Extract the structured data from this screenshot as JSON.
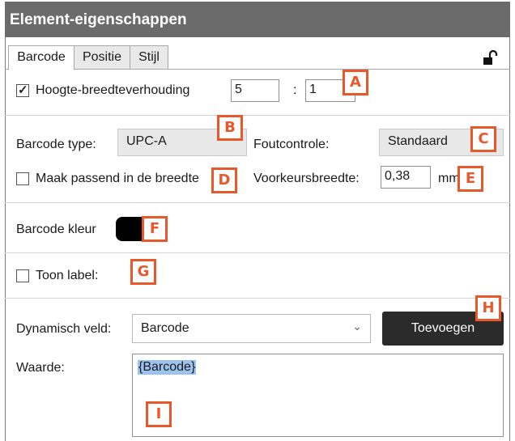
{
  "panel": {
    "title": "Element-eigenschappen"
  },
  "tabs": [
    {
      "label": "Barcode"
    },
    {
      "label": "Positie"
    },
    {
      "label": "Stijl"
    }
  ],
  "aspect": {
    "checkbox_label": "Hoogte-breedteverhouding",
    "checked": true,
    "check_glyph": "✓",
    "ratio_a": "5",
    "separator": ":",
    "ratio_b": "1"
  },
  "barcode": {
    "type_label": "Barcode type:",
    "type_value": "UPC-A",
    "error_label": "Foutcontrole:",
    "error_value": "Standaard",
    "fit_label": "Maak passend in de breedte",
    "fit_checked": false,
    "pref_width_label": "Voorkeursbreedte:",
    "pref_width_value": "0,38",
    "pref_width_unit": "mm"
  },
  "color": {
    "label": "Barcode kleur",
    "value": "#000000"
  },
  "show_label": {
    "label": "Toon label:",
    "checked": false
  },
  "dynamic": {
    "field_label": "Dynamisch veld:",
    "field_value": "Barcode",
    "add_button": "Toevoegen",
    "value_label": "Waarde:",
    "value_text": "{Barcode}"
  },
  "callouts": [
    "A",
    "B",
    "C",
    "D",
    "E",
    "F",
    "G",
    "H",
    "I"
  ],
  "colors": {
    "titlebar": "#6b6b6b",
    "callout": "#e8582b",
    "button": "#2b2b2b",
    "selection": "#9cc3ef"
  }
}
